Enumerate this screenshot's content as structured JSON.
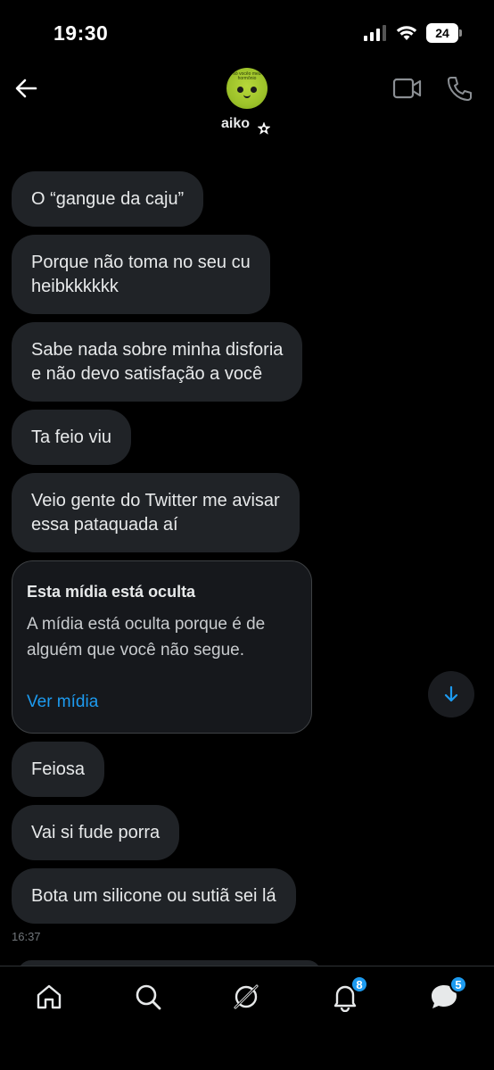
{
  "status_bar": {
    "time": "19:30",
    "battery": "24"
  },
  "header": {
    "contact_name": "aiko",
    "avatar_text": "só vocêo meu hormônio"
  },
  "messages": [
    {
      "lines": [
        "O “gangue da caju”"
      ]
    },
    {
      "lines": [
        "Porque não toma no seu cu",
        "heibkkkkkk"
      ]
    },
    {
      "lines": [
        "Sabe nada sobre minha disforia",
        "e não devo satisfação a você"
      ]
    },
    {
      "lines": [
        "Ta feio viu"
      ]
    },
    {
      "lines": [
        "Veio gente do Twitter me avisar",
        "essa pataquada aí"
      ]
    }
  ],
  "hidden_media": {
    "title": "Esta mídia está oculta",
    "body": "A mídia está oculta porque é de alguém que você não segue.",
    "link": "Ver mídia"
  },
  "messages_after": [
    {
      "lines": [
        "Feiosa"
      ]
    },
    {
      "lines": [
        "Vai si fude porra"
      ]
    },
    {
      "lines": [
        "Bota um silicone ou sutiã sei lá"
      ]
    }
  ],
  "timestamp": "16:37",
  "tabbar": {
    "notifications_badge": "8",
    "messages_badge": "5"
  },
  "colors": {
    "accent": "#1d9bf0",
    "bubble": "#202327",
    "background": "#000000"
  },
  "icons": [
    "back-arrow-icon",
    "video-camera-icon",
    "phone-icon",
    "verified-star-icon",
    "arrow-down-icon",
    "home-icon",
    "search-icon",
    "grok-icon",
    "bell-icon",
    "messages-icon"
  ]
}
